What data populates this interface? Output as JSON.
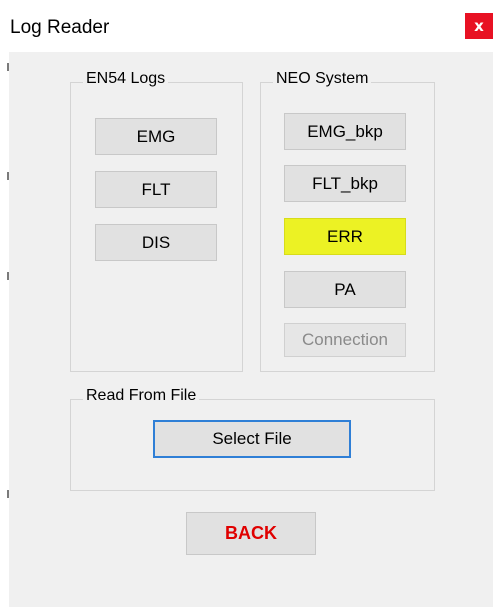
{
  "window": {
    "title": "Log Reader",
    "close_label": "x"
  },
  "en54": {
    "title": "EN54 Logs",
    "buttons": [
      "EMG",
      "FLT",
      "DIS"
    ]
  },
  "neo": {
    "title": "NEO System",
    "buttons": [
      "EMG_bkp",
      "FLT_bkp",
      "ERR",
      "PA"
    ],
    "disabled_button": "Connection",
    "highlight_color": "#ecf224"
  },
  "file": {
    "title": "Read From File",
    "select_label": "Select File"
  },
  "back_label": "BACK",
  "colors": {
    "back_text": "#e00000",
    "focus_border": "#2f7fd6",
    "close_bg": "#e81123"
  }
}
